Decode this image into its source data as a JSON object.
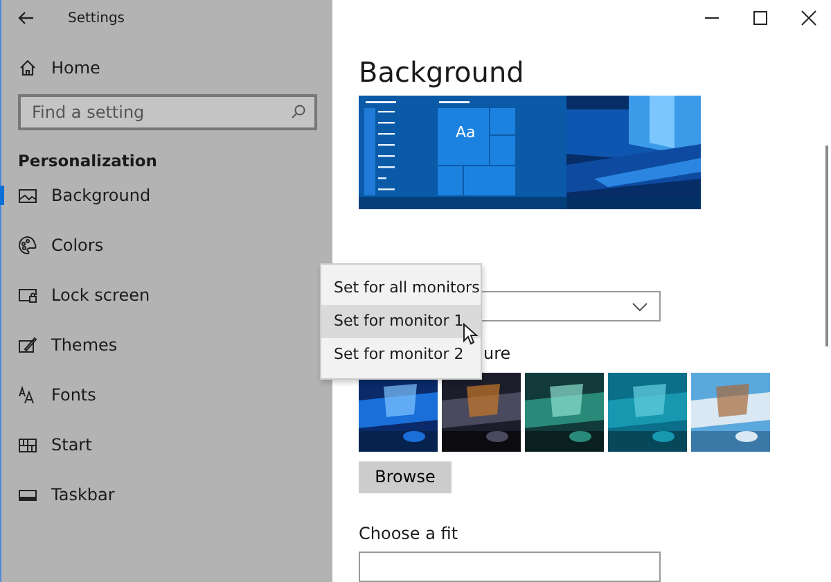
{
  "window": {
    "title": "Settings"
  },
  "sidebar": {
    "home": "Home",
    "search": {
      "placeholder": "Find a setting"
    },
    "section": "Personalization",
    "items": [
      {
        "label": "Background",
        "selected": true
      },
      {
        "label": "Colors",
        "selected": false
      },
      {
        "label": "Lock screen",
        "selected": false
      },
      {
        "label": "Themes",
        "selected": false
      },
      {
        "label": "Fonts",
        "selected": false
      },
      {
        "label": "Start",
        "selected": false
      },
      {
        "label": "Taskbar",
        "selected": false
      }
    ]
  },
  "page": {
    "heading": "Background",
    "preview_tile": "Aa",
    "picture_label": "ure",
    "browse": "Browse",
    "fit_label": "Choose a fit"
  },
  "context_menu": [
    {
      "label": "Set for all monitors",
      "selected": false
    },
    {
      "label": "Set for monitor 1",
      "selected": true
    },
    {
      "label": "Set for monitor 2",
      "selected": false
    }
  ]
}
